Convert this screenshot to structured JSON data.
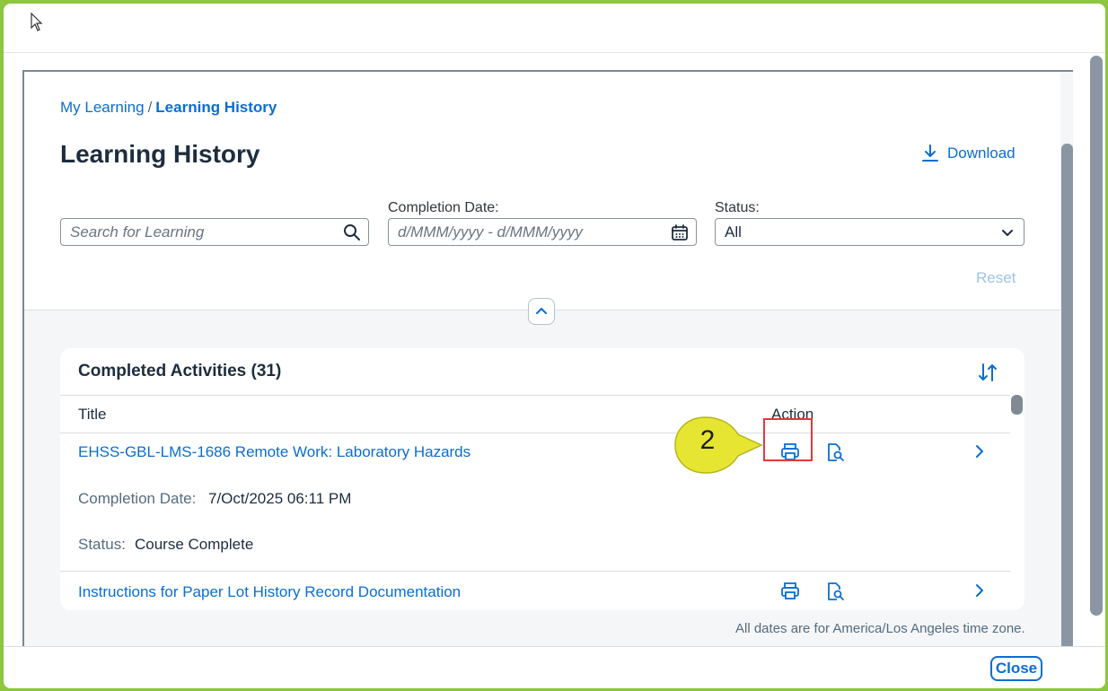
{
  "breadcrumb": {
    "root": "My Learning",
    "separator": "/",
    "current": "Learning History"
  },
  "page": {
    "title": "Learning History",
    "download_label": "Download",
    "reset_label": "Reset"
  },
  "filters": {
    "search_placeholder": "Search for Learning",
    "date_label": "Completion Date:",
    "date_placeholder": "d/MMM/yyyy - d/MMM/yyyy",
    "status_label": "Status:",
    "status_value": "All"
  },
  "card": {
    "title": "Completed Activities (31)",
    "columns": {
      "title": "Title",
      "action": "Action"
    },
    "rows": [
      {
        "title": "EHSS-GBL-LMS-1686 Remote Work: Laboratory Hazards",
        "completion_label": "Completion Date:",
        "completion_value": "7/Oct/2025 06:11 PM",
        "status_label": "Status:",
        "status_value": "Course Complete"
      },
      {
        "title": "Instructions for Paper Lot History Record Documentation"
      }
    ]
  },
  "timezone_note": "All dates are for America/Los Angeles time zone.",
  "footer": {
    "close_label": "Close"
  },
  "callout": {
    "number": "2",
    "color": "#e6e632"
  },
  "colors": {
    "accent": "#0a6ed1",
    "highlight": "#e03a3a",
    "frame": "#8dc63f"
  }
}
